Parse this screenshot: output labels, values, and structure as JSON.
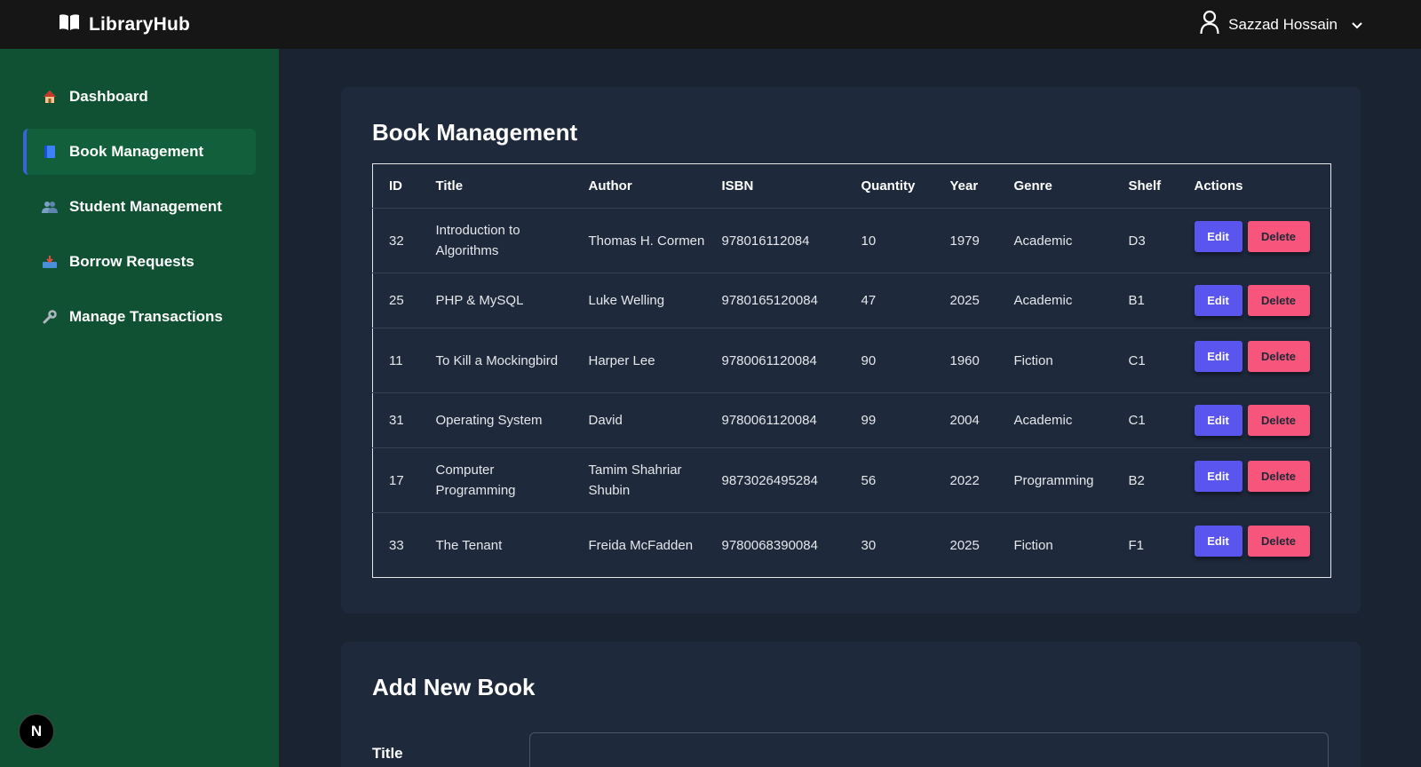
{
  "app": {
    "brand": "LibraryHub"
  },
  "user": {
    "name": "Sazzad Hossain"
  },
  "sidebar": {
    "items": [
      {
        "label": "Dashboard",
        "icon": "house-icon",
        "active": false
      },
      {
        "label": "Book Management",
        "icon": "book-icon",
        "active": true
      },
      {
        "label": "Student Management",
        "icon": "users-icon",
        "active": false
      },
      {
        "label": "Borrow Requests",
        "icon": "inbox-tray-icon",
        "active": false
      },
      {
        "label": "Manage Transactions",
        "icon": "wrench-icon",
        "active": false
      }
    ],
    "badge": "N"
  },
  "books": {
    "title": "Book Management",
    "columns": [
      "ID",
      "Title",
      "Author",
      "ISBN",
      "Quantity",
      "Year",
      "Genre",
      "Shelf",
      "Actions"
    ],
    "edit_label": "Edit",
    "delete_label": "Delete",
    "rows": [
      {
        "id": "32",
        "title": "Introduction to Algorithms",
        "author": "Thomas H. Cormen",
        "isbn": "978016112084",
        "quantity": "10",
        "year": "1979",
        "genre": "Academic",
        "shelf": "D3"
      },
      {
        "id": "25",
        "title": "PHP & MySQL",
        "author": "Luke Welling",
        "isbn": "9780165120084",
        "quantity": "47",
        "year": "2025",
        "genre": "Academic",
        "shelf": "B1"
      },
      {
        "id": "11",
        "title": "To Kill a Mockingbird",
        "author": "Harper Lee",
        "isbn": "9780061120084",
        "quantity": "90",
        "year": "1960",
        "genre": "Fiction",
        "shelf": "C1"
      },
      {
        "id": "31",
        "title": "Operating System",
        "author": "David",
        "isbn": "9780061120084",
        "quantity": "99",
        "year": "2004",
        "genre": "Academic",
        "shelf": "C1"
      },
      {
        "id": "17",
        "title": "Computer Programming",
        "author": "Tamim Shahriar Shubin",
        "isbn": "9873026495284",
        "quantity": "56",
        "year": "2022",
        "genre": "Programming",
        "shelf": "B2"
      },
      {
        "id": "33",
        "title": "The Tenant",
        "author": "Freida McFadden",
        "isbn": "9780068390084",
        "quantity": "30",
        "year": "2025",
        "genre": "Fiction",
        "shelf": "F1"
      }
    ]
  },
  "add_book": {
    "title": "Add New Book",
    "title_label": "Title",
    "title_value": ""
  },
  "colors": {
    "sidebar": "#0f5132",
    "topbar": "#161616",
    "content_bg": "#1a2332",
    "card_bg": "#1e293b",
    "edit": "#5b55f0",
    "delete": "#f7557b"
  }
}
